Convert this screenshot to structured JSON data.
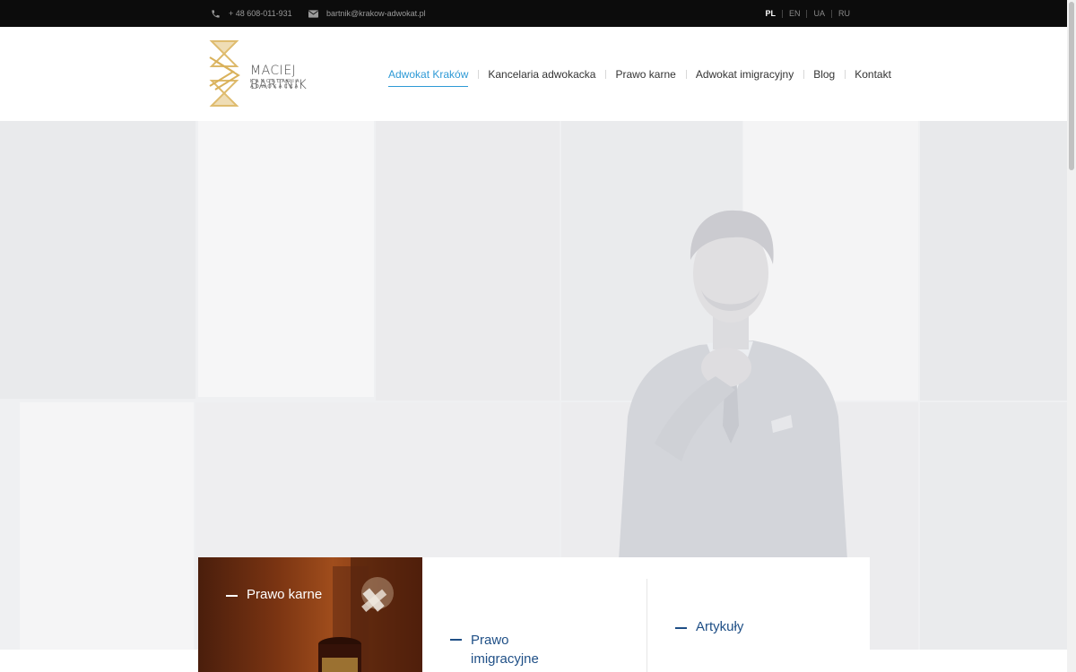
{
  "topbar": {
    "phone": "+ 48 608-011-931",
    "phone_icon": "phone-icon",
    "email": "bartnik@krakow-adwokat.pl",
    "email_icon": "envelope-icon",
    "languages": [
      "PL",
      "EN",
      "UA",
      "RU"
    ],
    "active_language": "PL"
  },
  "logo": {
    "name": "MACIEJ BARTNIK",
    "subtitle": "KANCELARIA ADWOKACKA",
    "accent": "#d9b15a"
  },
  "nav": {
    "items": [
      "Adwokat Kraków",
      "Kancelaria adwokacka",
      "Prawo karne",
      "Adwokat imigracyjny",
      "Blog",
      "Kontakt"
    ],
    "active_index": 0,
    "active_color": "#2e9ad6"
  },
  "cards": [
    {
      "title": "Prawo karne"
    },
    {
      "title": "Prawo imigracyjne"
    },
    {
      "title": "Artykuły"
    }
  ],
  "colors": {
    "card_title": "#1f4f86",
    "topbar_bg": "#0c0c0c"
  }
}
